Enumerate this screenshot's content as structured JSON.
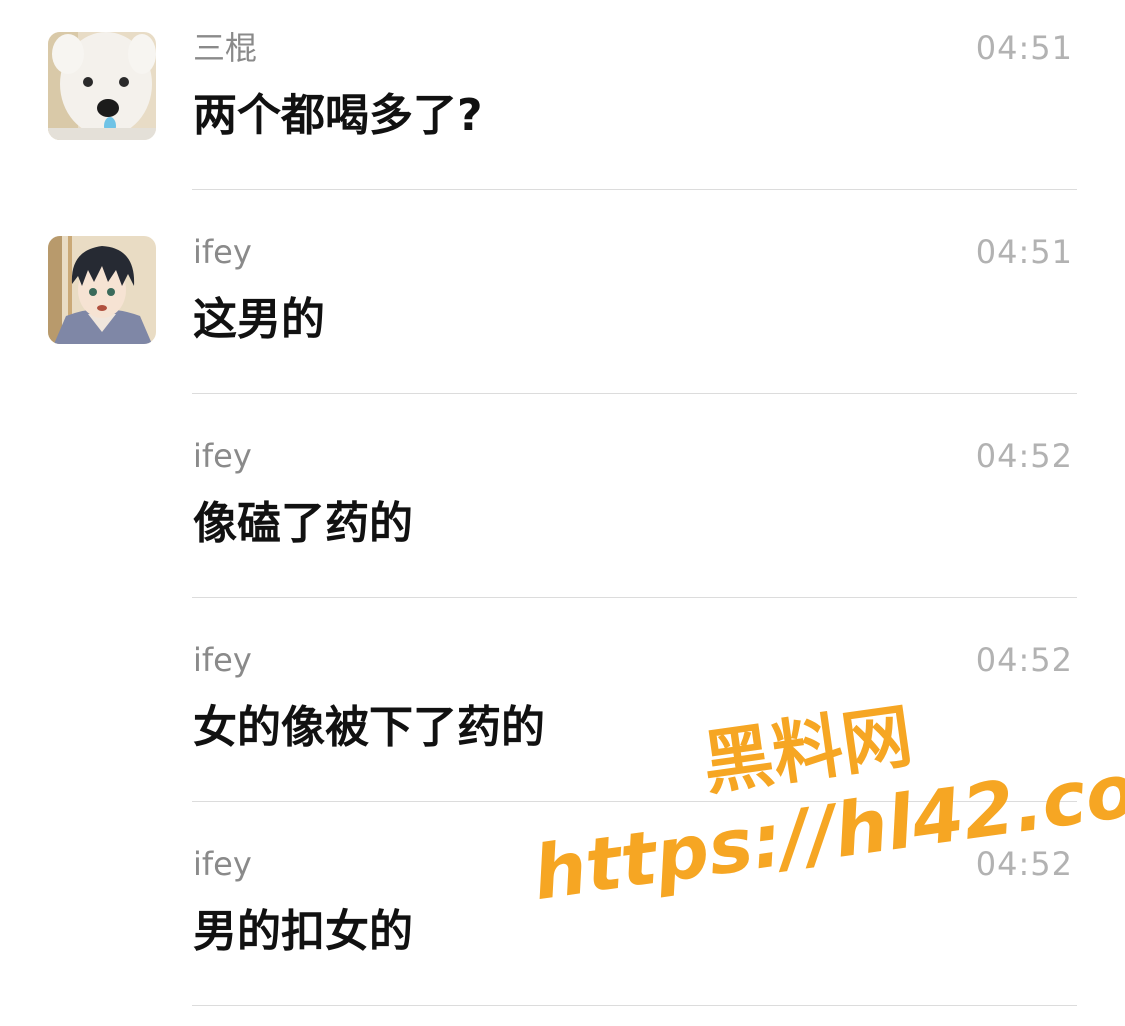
{
  "messages": [
    {
      "sender": "三棍",
      "time": "04:51",
      "text": "两个都喝多了?",
      "avatar": "dog-avatar"
    },
    {
      "sender": "ifey",
      "time": "04:51",
      "text": "这男的",
      "avatar": "anime-boy-avatar"
    },
    {
      "sender": "ifey",
      "time": "04:52",
      "text": "像磕了药的",
      "avatar": ""
    },
    {
      "sender": "ifey",
      "time": "04:52",
      "text": "女的像被下了药的",
      "avatar": ""
    },
    {
      "sender": "ifey",
      "time": "04:52",
      "text": "男的扣女的",
      "avatar": ""
    }
  ],
  "watermark": {
    "line1": "黑料网",
    "line2": "https://hl42.co"
  },
  "colors": {
    "sender": "#8a8a8a",
    "time": "#b2b2b2",
    "text": "#111111",
    "divider": "#dcdcdc",
    "watermark": "#f6a623"
  }
}
